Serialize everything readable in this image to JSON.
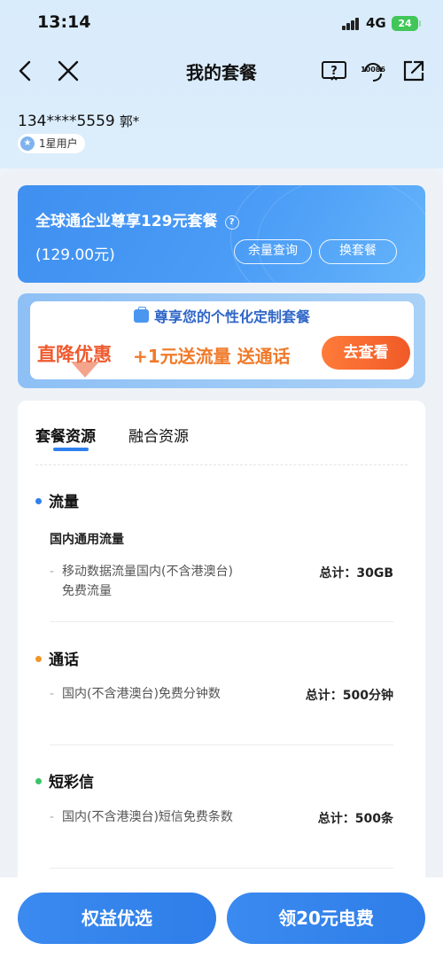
{
  "status_bar": {
    "time": "13:14",
    "network": "4G",
    "battery": "24"
  },
  "nav": {
    "title": "我的套餐",
    "hotline_label": "10086"
  },
  "user": {
    "phone": "134****5559",
    "name": "郭*",
    "level": "1星用户"
  },
  "plan": {
    "name": "全球通企业尊享129元套餐",
    "price": "(129.00元)",
    "balance_button": "余量查询",
    "change_button": "换套餐"
  },
  "promo": {
    "headline": "尊享您的个性化定制套餐",
    "left_text": "直降优惠",
    "mid_text": "+1元送流量 送通话",
    "button": "去查看"
  },
  "tabs": [
    {
      "label": "套餐资源"
    },
    {
      "label": "融合资源"
    }
  ],
  "sections": {
    "data": {
      "title": "流量",
      "subtitle": "国内通用流量",
      "desc": "移动数据流量国内(不含港澳台)免费流量",
      "total": "总计：30GB",
      "color": "#2f80ed"
    },
    "voice": {
      "title": "通话",
      "desc": "国内(不含港澳台)免费分钟数",
      "total": "总计：500分钟",
      "color": "#f0962a"
    },
    "sms": {
      "title": "短彩信",
      "desc": "国内(不含港澳台)短信免费条数",
      "total": "总计：500条",
      "color": "#3bc46a"
    }
  },
  "bottom": {
    "left_button": "权益优选",
    "right_button": "领20元电费"
  }
}
